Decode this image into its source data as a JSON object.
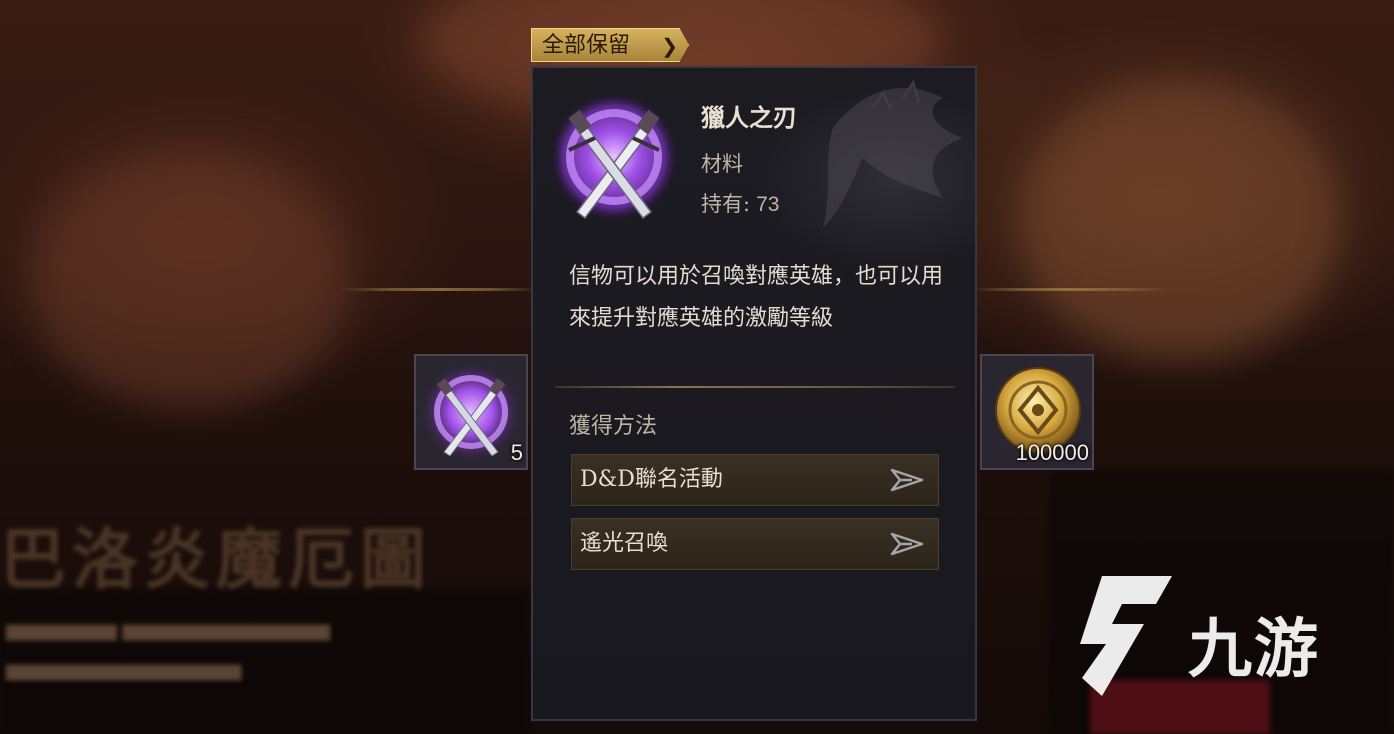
{
  "toolbar": {
    "keep_all_label": "全部保留"
  },
  "item": {
    "name": "獵人之刃",
    "type": "材料",
    "owned_label": "持有:",
    "owned_count": "73",
    "description": "信物可以用於召喚對應英雄，也可以用來提升對應英雄的激勵等級"
  },
  "sources": {
    "title": "獲得方法",
    "items": [
      {
        "label": "D&D聯名活動"
      },
      {
        "label": "遙光召喚"
      }
    ]
  },
  "left_slot": {
    "count": "5",
    "icon": "crossed-daggers-icon"
  },
  "right_slot": {
    "count": "100000",
    "icon": "gold-coin-icon"
  },
  "background": {
    "title": "巴洛炎魔厄圖"
  },
  "watermark": {
    "text": "九游"
  },
  "colors": {
    "accent_gold": "#d6b25e",
    "panel_bg": "#1d1b22",
    "purple_glow": "#a050e8"
  }
}
